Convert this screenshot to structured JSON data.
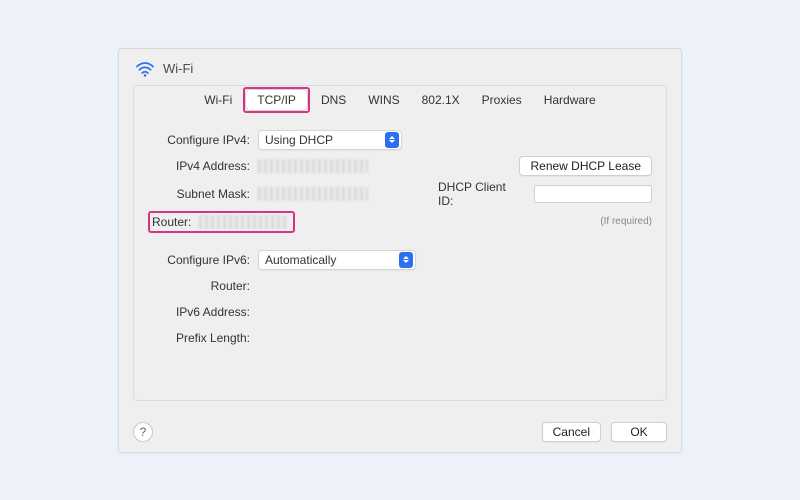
{
  "header": {
    "title": "Wi-Fi"
  },
  "tabs": {
    "items": [
      "Wi-Fi",
      "TCP/IP",
      "DNS",
      "WINS",
      "802.1X",
      "Proxies",
      "Hardware"
    ],
    "active_index": 1,
    "highlight_index": 1
  },
  "ipv4": {
    "configure_label": "Configure IPv4:",
    "configure_value": "Using DHCP",
    "address_label": "IPv4 Address:",
    "subnet_label": "Subnet Mask:",
    "router_label": "Router:",
    "renew_button": "Renew DHCP Lease",
    "client_id_label": "DHCP Client ID:",
    "client_id_value": "",
    "client_id_hint": "(If required)"
  },
  "ipv6": {
    "configure_label": "Configure IPv6:",
    "configure_value": "Automatically",
    "router_label": "Router:",
    "address_label": "IPv6 Address:",
    "prefix_label": "Prefix Length:"
  },
  "footer": {
    "help": "?",
    "cancel": "Cancel",
    "ok": "OK"
  },
  "highlight": {
    "router_row": true
  }
}
